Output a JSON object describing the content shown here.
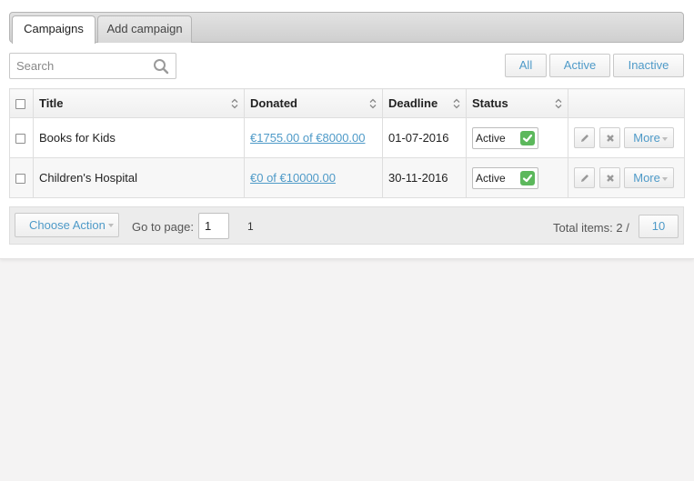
{
  "tabs": [
    {
      "label": "Campaigns",
      "active": true
    },
    {
      "label": "Add campaign",
      "active": false
    }
  ],
  "search": {
    "placeholder": "Search",
    "value": ""
  },
  "filters": [
    {
      "label": "All"
    },
    {
      "label": "Active"
    },
    {
      "label": "Inactive"
    }
  ],
  "table": {
    "columns": [
      "Title",
      "Donated",
      "Deadline",
      "Status"
    ],
    "rows": [
      {
        "title": "Books for Kids",
        "donated": "€1755.00 of €8000.00",
        "deadline": "01-07-2016",
        "status": "Active"
      },
      {
        "title": "Children's Hospital",
        "donated": "€0 of €10000.00",
        "deadline": "30-11-2016",
        "status": "Active"
      }
    ],
    "more_label": "More"
  },
  "footer": {
    "choose_action": "Choose Action",
    "goto_label": "Go to page:",
    "page_value": "1",
    "page_number": "1",
    "total_label": "Total items: 2 /",
    "per_page": "10"
  },
  "colors": {
    "link": "#4e9ac8",
    "status_check": "#5cb85c",
    "page_background": "#f4f3f3"
  }
}
